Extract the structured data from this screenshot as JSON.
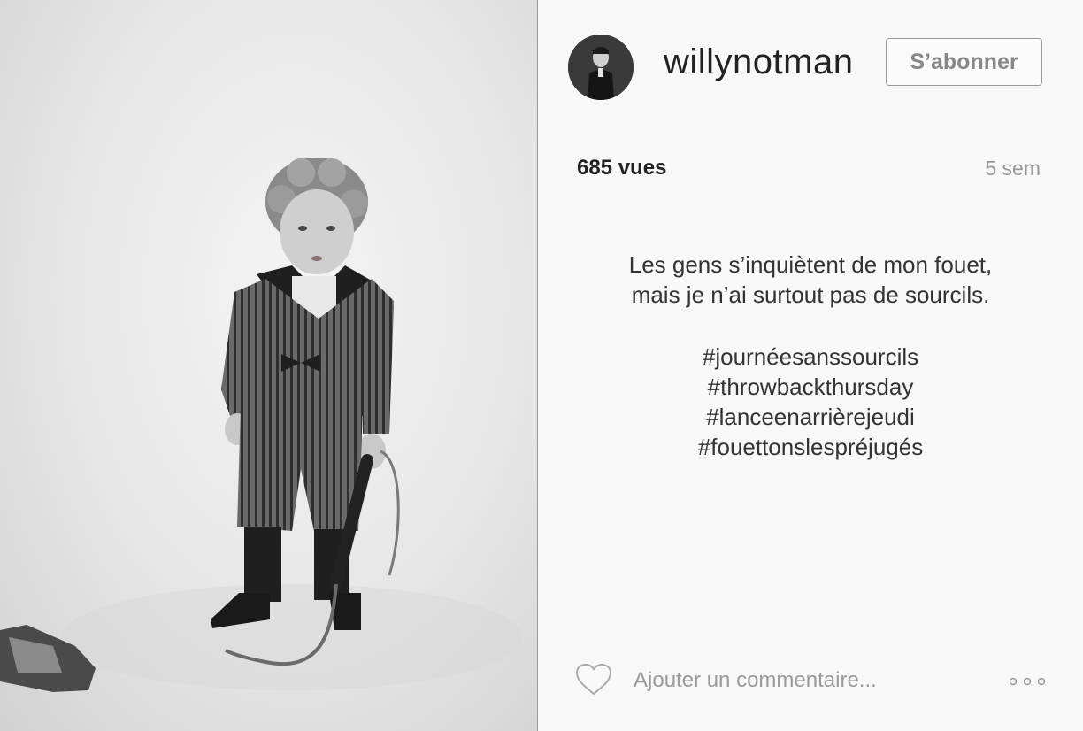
{
  "post": {
    "username": "willynotman",
    "follow_label": "S’abonner",
    "views": "685 vues",
    "time_ago": "5 sem",
    "caption_lines": [
      "Les gens s’inquiètent de mon fouet,",
      "mais je n’ai surtout pas de sourcils."
    ],
    "hashtags": [
      "#journéesanssourcils",
      "#throwbackthursday",
      "#lanceenarrièrejeudi",
      "#fouettonslespréjugés"
    ],
    "comment_placeholder": "Ajouter un commentaire..."
  },
  "icons": {
    "like": "heart-icon",
    "more": "more-options-icon"
  },
  "colors": {
    "panel_background": "#f8f8f8",
    "text_primary": "#222222",
    "text_muted": "#999999",
    "button_border": "#9a9a9a"
  }
}
